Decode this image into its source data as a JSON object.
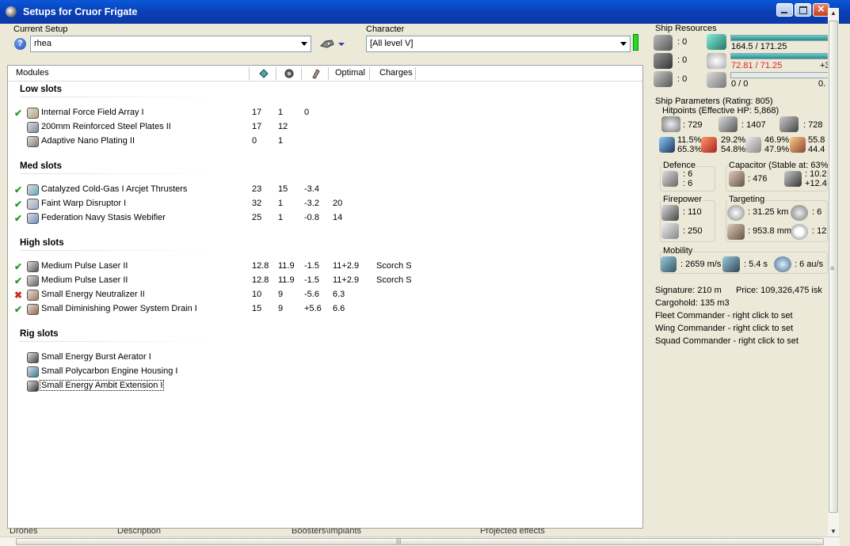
{
  "window": {
    "title": "Setups for Cruor Frigate"
  },
  "setup": {
    "label": "Current Setup",
    "value": "rhea"
  },
  "character": {
    "label": "Character",
    "value": "[All level V]"
  },
  "modules_header": {
    "modules": "Modules",
    "optimal": "Optimal",
    "charges": "Charges"
  },
  "sections": {
    "low": "Low slots",
    "med": "Med slots",
    "high": "High slots",
    "rig": "Rig slots"
  },
  "low_modules": [
    {
      "status": "ok",
      "name": "Internal Force Field Array I",
      "cpu": "17",
      "pg": "1",
      "cap": "0",
      "optimal": "",
      "charges": ""
    },
    {
      "status": "",
      "name": "200mm Reinforced Steel Plates II",
      "cpu": "17",
      "pg": "12",
      "cap": "",
      "optimal": "",
      "charges": ""
    },
    {
      "status": "",
      "name": "Adaptive Nano Plating II",
      "cpu": "0",
      "pg": "1",
      "cap": "",
      "optimal": "",
      "charges": ""
    }
  ],
  "med_modules": [
    {
      "status": "ok",
      "name": "Catalyzed Cold-Gas I Arcjet Thrusters",
      "cpu": "23",
      "pg": "15",
      "cap": "-3.4",
      "optimal": "",
      "charges": ""
    },
    {
      "status": "ok",
      "name": "Faint Warp Disruptor I",
      "cpu": "32",
      "pg": "1",
      "cap": "-3.2",
      "optimal": "20",
      "charges": ""
    },
    {
      "status": "ok",
      "name": "Federation Navy Stasis Webifier",
      "cpu": "25",
      "pg": "1",
      "cap": "-0.8",
      "optimal": "14",
      "charges": ""
    }
  ],
  "high_modules": [
    {
      "status": "ok",
      "name": "Medium Pulse Laser II",
      "cpu": "12.8",
      "pg": "11.9",
      "cap": "-1.5",
      "optimal": "11+2.9",
      "charges": "Scorch S"
    },
    {
      "status": "ok",
      "name": "Medium Pulse Laser II",
      "cpu": "12.8",
      "pg": "11.9",
      "cap": "-1.5",
      "optimal": "11+2.9",
      "charges": "Scorch S"
    },
    {
      "status": "bad",
      "name": "Small Energy Neutralizer II",
      "cpu": "10",
      "pg": "9",
      "cap": "-5.6",
      "optimal": "6.3",
      "charges": ""
    },
    {
      "status": "ok",
      "name": "Small Diminishing Power System Drain I",
      "cpu": "15",
      "pg": "9",
      "cap": "+5.6",
      "optimal": "6.6",
      "charges": ""
    }
  ],
  "rig_modules": [
    {
      "name": "Small Energy Burst Aerator I"
    },
    {
      "name": "Small Polycarbon Engine Housing I"
    },
    {
      "name": "Small Energy Ambit Extension I"
    }
  ],
  "bottom_tabs": [
    "Drones",
    "Description",
    "Boosters\\Implants",
    "Projected effects"
  ],
  "resources": {
    "title": "Ship Resources",
    "turret": ": 0",
    "launcher": ": 0",
    "drone": ": 0",
    "cpu": "164.5 / 171.25",
    "powergrid": "72.81 / 71.25",
    "powergrid_extra": "+3",
    "calibration": "0 / 0",
    "calibration_extra": "0.",
    "cpu_fill": 0.96,
    "pg_fill": 1.0,
    "cal_fill": 0.0
  },
  "params": {
    "title": "Ship Parameters (Rating: 805)",
    "hitpoints": "Hitpoints (Effective HP: 5,868)",
    "shield_hp": ": 729",
    "armor_hp": ": 1407",
    "structure_hp": ": 728",
    "em_1": "11.5%",
    "em_2": "65.3%",
    "therm_1": "29.2%",
    "therm_2": "54.8%",
    "kin_1": "46.9%",
    "kin_2": "47.9%",
    "exp_1": "55.8",
    "exp_2": "44.4",
    "defence_title": "Defence",
    "defence_1": ": 6",
    "defence_2": ": 6",
    "capacitor_title": "Capacitor (Stable at: 63%)",
    "cap_amount": ": 476",
    "cap_1": ": 10.2",
    "cap_2": "+12.4",
    "firepower_title": "Firepower",
    "firepower_1": ": 110",
    "firepower_2": ": 250",
    "targeting_title": "Targeting",
    "range": ": 31.25 km",
    "max_targets": ": 6",
    "scan_res": ": 953.8 mm",
    "sensor": ": 12",
    "mobility_title": "Mobility",
    "speed": ": 2659 m/s",
    "align": ": 5.4 s",
    "warp": ": 6 au/s",
    "signature": "Signature: 210 m",
    "price": "Price: 109,326,475 isk",
    "cargo": "Cargohold: 135 m3",
    "fleet": "Fleet Commander - right click to set",
    "wing": "Wing Commander - right click to set",
    "squad": "Squad Commander - right click to set"
  },
  "icons": {
    "help": "help-icon",
    "drone_options": "drone-icon",
    "status_ok": "check-icon",
    "status_bad": "cross-icon"
  },
  "glyphs": {
    "help": "?",
    "check": "✔",
    "cross": "✖",
    "grip_h": "|||",
    "grip_v": "≡",
    "up": "▲",
    "down": "▼"
  }
}
